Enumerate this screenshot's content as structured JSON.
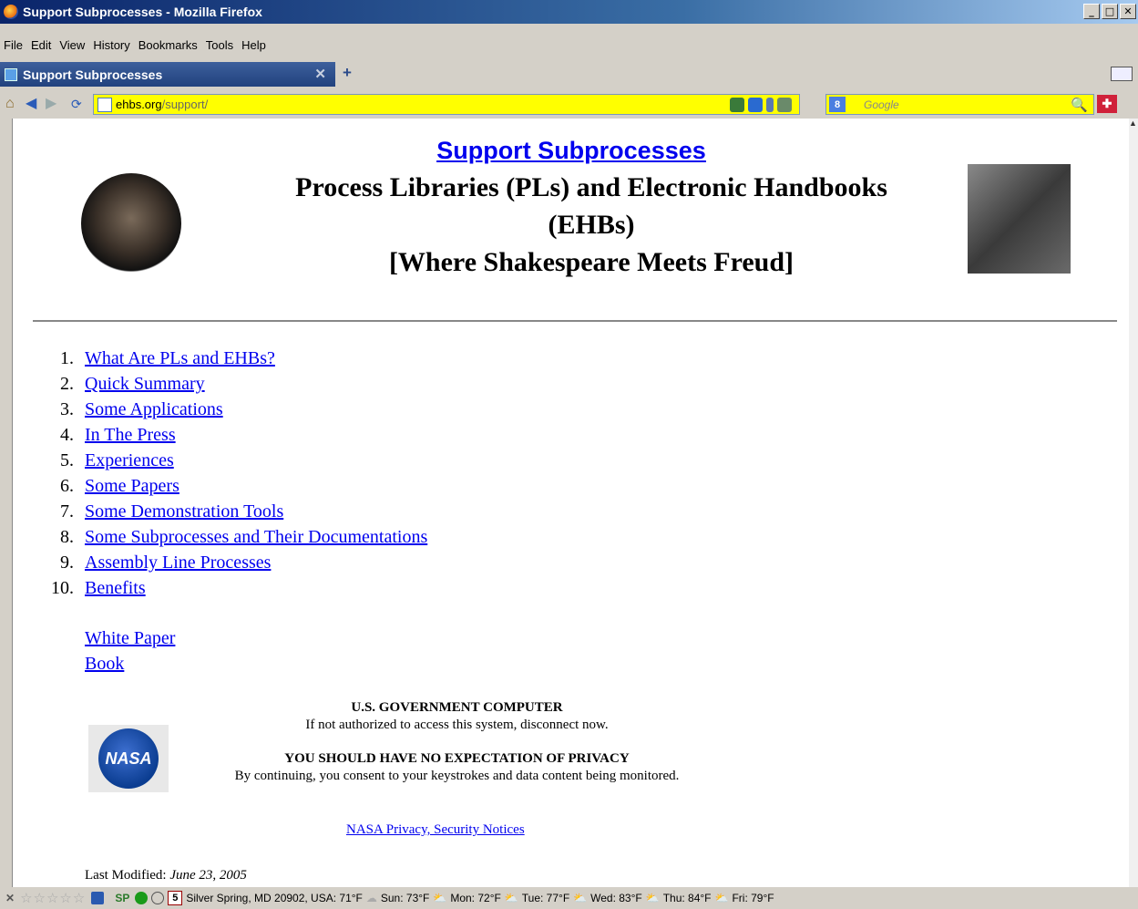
{
  "window": {
    "title": "Support Subprocesses - Mozilla Firefox",
    "buttons": [
      "_",
      "□",
      "✕"
    ]
  },
  "menu": [
    "File",
    "Edit",
    "View",
    "History",
    "Bookmarks",
    "Tools",
    "Help"
  ],
  "tab": {
    "title": "Support Subprocesses",
    "close": "✕",
    "new_tab": "+"
  },
  "address": {
    "host": "ehbs.org",
    "path": "/support/"
  },
  "search": {
    "engine": "8",
    "placeholder": "Google"
  },
  "page": {
    "heading_link": "Support Subprocesses",
    "title_line1": "Process Libraries (PLs) and Electronic Handbooks",
    "title_line2": "(EHBs)",
    "title_line3": "[Where Shakespeare Meets Freud]",
    "toc": [
      {
        "num": "1.",
        "label": "What Are PLs and EHBs?"
      },
      {
        "num": "2.",
        "label": "Quick Summary"
      },
      {
        "num": "3.",
        "label": "Some Applications"
      },
      {
        "num": "4.",
        "label": "In The Press"
      },
      {
        "num": "5.",
        "label": "Experiences"
      },
      {
        "num": "6.",
        "label": "Some Papers"
      },
      {
        "num": "7.",
        "label": "Some Demonstration Tools"
      },
      {
        "num": "8.",
        "label": "Some Subprocesses and Their Documentations"
      },
      {
        "num": "9.",
        "label": "Assembly Line Processes"
      },
      {
        "num": "10.",
        "label": "Benefits"
      }
    ],
    "white_paper": "White Paper",
    "book": "Book",
    "notice_head1": "U.S. GOVERNMENT COMPUTER",
    "notice_text1": "If not authorized to access this system, disconnect now.",
    "notice_head2": "YOU SHOULD HAVE NO EXPECTATION OF PRIVACY",
    "notice_text2": "By continuing, you consent to your keystrokes and data content being monitored.",
    "nasa_logo": "NASA",
    "privacy_link": "NASA Privacy, Security Notices",
    "last_modified_label": "Last Modified:",
    "last_modified_date": "June 23, 2005"
  },
  "status": {
    "stars": "☆☆☆☆☆",
    "sp": "SP",
    "calendar_day": "5",
    "location": "Silver Spring, MD 20902, USA: 71°F",
    "forecast": [
      {
        "day": "Sun: 73°F",
        "icon": "cloud"
      },
      {
        "day": "Mon: 72°F",
        "icon": "partly-sunny"
      },
      {
        "day": "Tue: 77°F",
        "icon": "partly-sunny"
      },
      {
        "day": "Wed: 83°F",
        "icon": "partly-sunny"
      },
      {
        "day": "Thu: 84°F",
        "icon": "partly-sunny"
      },
      {
        "day": "Fri: 79°F",
        "icon": "partly-sunny"
      }
    ]
  },
  "colors": {
    "link": "#0000ee",
    "urlbar": "#ffff00",
    "titlebar": "#0a246a"
  }
}
